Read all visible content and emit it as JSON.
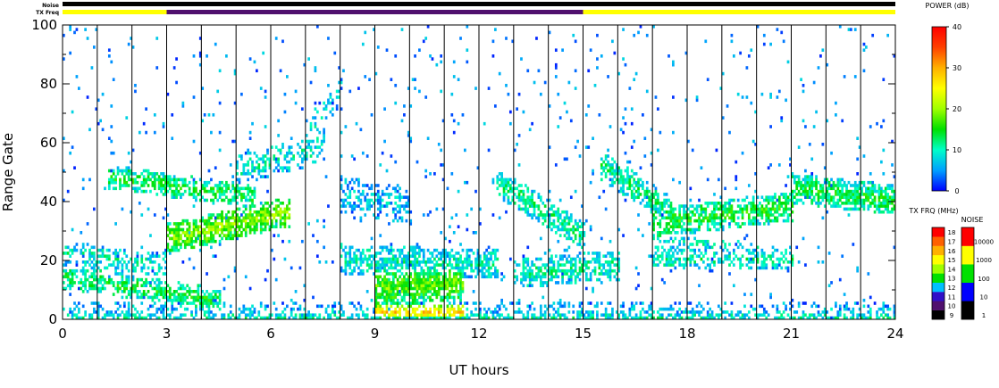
{
  "chart_data": {
    "type": "heatmap",
    "xlabel": "UT hours",
    "ylabel": "Range Gate",
    "xlim": [
      0,
      24
    ],
    "ylim": [
      0,
      100
    ],
    "x_ticks": [
      0,
      3,
      6,
      9,
      12,
      15,
      18,
      21,
      24
    ],
    "y_ticks": [
      0,
      20,
      40,
      60,
      80,
      100
    ],
    "vertical_markers_ut": [
      1,
      2,
      3,
      4,
      5,
      6,
      7,
      8,
      9,
      10,
      11,
      12,
      13,
      14,
      15,
      16,
      17,
      18,
      19,
      20,
      21,
      22,
      23
    ],
    "status_bars": {
      "noise_label": "Noise",
      "txfreq_label": "TX Freq",
      "noise_segments": [
        {
          "start": 0,
          "end": 24,
          "color": "#000000"
        }
      ],
      "txfreq_segments": [
        {
          "start": 0,
          "end": 3,
          "color": "#ffff00"
        },
        {
          "start": 3,
          "end": 15,
          "color": "#50106e"
        },
        {
          "start": 15,
          "end": 24,
          "color": "#ffff00"
        }
      ]
    },
    "echo_bands": [
      {
        "t0": 0,
        "t1": 24,
        "g0": 0,
        "g1": 0,
        "w": 2,
        "p": 10,
        "d": 0.6
      },
      {
        "t0": 0,
        "t1": 24,
        "g0": 2,
        "g1": 2,
        "w": 3,
        "p": 7,
        "d": 0.35
      },
      {
        "t0": 9,
        "t1": 11.5,
        "g0": 2,
        "g1": 2,
        "w": 2,
        "p": 28,
        "d": 0.8
      },
      {
        "t0": 0,
        "t1": 4.5,
        "g0": 14,
        "g1": 6,
        "w": 4,
        "p": 14,
        "d": 0.65
      },
      {
        "t0": 0,
        "t1": 3,
        "g0": 22,
        "g1": 18,
        "w": 4,
        "p": 10,
        "d": 0.5
      },
      {
        "t0": 3,
        "t1": 6.5,
        "g0": 27,
        "g1": 36,
        "w": 5,
        "p": 20,
        "d": 0.85
      },
      {
        "t0": 1.3,
        "t1": 5.5,
        "g0": 48,
        "g1": 41,
        "w": 4,
        "p": 14,
        "d": 0.7
      },
      {
        "t0": 5,
        "t1": 7.5,
        "g0": 50,
        "g1": 58,
        "w": 5,
        "p": 10,
        "d": 0.45
      },
      {
        "t0": 7,
        "t1": 8,
        "g0": 62,
        "g1": 76,
        "w": 6,
        "p": 8,
        "d": 0.35
      },
      {
        "t0": 8,
        "t1": 12.5,
        "g0": 20,
        "g1": 18,
        "w": 5,
        "p": 10,
        "d": 0.75
      },
      {
        "t0": 9,
        "t1": 11.5,
        "g0": 10,
        "g1": 12,
        "w": 6,
        "p": 18,
        "d": 0.95
      },
      {
        "t0": 8,
        "t1": 10,
        "g0": 42,
        "g1": 38,
        "w": 6,
        "p": 7,
        "d": 0.5
      },
      {
        "t0": 12.5,
        "t1": 15,
        "g0": 46,
        "g1": 28,
        "w": 5,
        "p": 12,
        "d": 0.7
      },
      {
        "t0": 13,
        "t1": 16,
        "g0": 15,
        "g1": 18,
        "w": 5,
        "p": 11,
        "d": 0.65
      },
      {
        "t0": 15.5,
        "t1": 17.5,
        "g0": 52,
        "g1": 36,
        "w": 5,
        "p": 12,
        "d": 0.7
      },
      {
        "t0": 17,
        "t1": 21,
        "g0": 32,
        "g1": 38,
        "w": 5,
        "p": 15,
        "d": 0.75
      },
      {
        "t0": 21,
        "t1": 24,
        "g0": 44,
        "g1": 40,
        "w": 5,
        "p": 14,
        "d": 0.8
      },
      {
        "t0": 17,
        "t1": 21,
        "g0": 20,
        "g1": 20,
        "w": 3,
        "p": 11,
        "d": 0.55
      },
      {
        "t0": 17,
        "t1": 20,
        "g0": 26,
        "g1": 24,
        "w": 2,
        "p": 9,
        "d": 0.35
      }
    ],
    "colorbars": {
      "power": {
        "label": "POWER (dB)",
        "ticks": [
          0,
          10,
          20,
          30,
          40
        ],
        "stops": [
          "#0000ff",
          "#00a0ff",
          "#00ffc8",
          "#00e000",
          "#a0ff00",
          "#ffff00",
          "#ffb000",
          "#ff4000",
          "#ff0000"
        ]
      },
      "txfreq": {
        "label": "TX FRQ (MHz)",
        "ticks": [
          9,
          10,
          11,
          12,
          13,
          14,
          15,
          16,
          17,
          18
        ],
        "colors": [
          "#000000",
          "#50106e",
          "#3010c8",
          "#00c0ff",
          "#00e000",
          "#a0ff00",
          "#ffff00",
          "#ffb000",
          "#ff6000",
          "#ff0000"
        ]
      },
      "noise": {
        "label": "NOISE",
        "ticks": [
          1,
          10,
          100,
          1000,
          10000
        ],
        "colors": [
          "#000000",
          "#0000ff",
          "#00e000",
          "#ffff00",
          "#ff0000"
        ]
      }
    }
  }
}
